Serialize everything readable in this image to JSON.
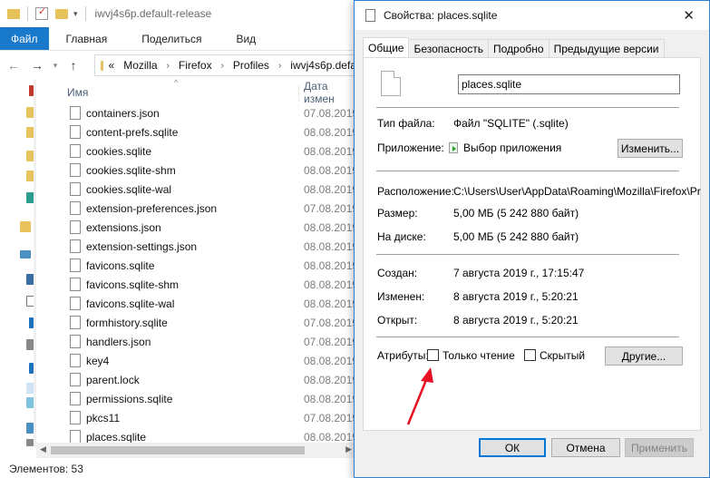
{
  "explorer": {
    "title": "iwvj4s6p.default-release",
    "ribbon_tabs": [
      "Файл",
      "Главная",
      "Поделиться",
      "Вид"
    ],
    "breadcrumb": [
      "«",
      "Mozilla",
      "Firefox",
      "Profiles",
      "iwvj4s6p.defa"
    ],
    "columns": {
      "name": "Имя",
      "date": "Дата измен"
    },
    "files": [
      {
        "name": "containers.json",
        "date": "07.08.2019"
      },
      {
        "name": "content-prefs.sqlite",
        "date": "08.08.2019"
      },
      {
        "name": "cookies.sqlite",
        "date": "08.08.2019"
      },
      {
        "name": "cookies.sqlite-shm",
        "date": "08.08.2019"
      },
      {
        "name": "cookies.sqlite-wal",
        "date": "08.08.2019"
      },
      {
        "name": "extension-preferences.json",
        "date": "07.08.2019"
      },
      {
        "name": "extensions.json",
        "date": "08.08.2019"
      },
      {
        "name": "extension-settings.json",
        "date": "08.08.2019"
      },
      {
        "name": "favicons.sqlite",
        "date": "08.08.2019"
      },
      {
        "name": "favicons.sqlite-shm",
        "date": "08.08.2019"
      },
      {
        "name": "favicons.sqlite-wal",
        "date": "08.08.2019"
      },
      {
        "name": "formhistory.sqlite",
        "date": "07.08.2019"
      },
      {
        "name": "handlers.json",
        "date": "07.08.2019"
      },
      {
        "name": "key4",
        "date": "08.08.2019"
      },
      {
        "name": "parent.lock",
        "date": "08.08.2019"
      },
      {
        "name": "permissions.sqlite",
        "date": "08.08.2019"
      },
      {
        "name": "pkcs11",
        "date": "07.08.2019"
      },
      {
        "name": "places.sqlite",
        "date": "08.08.2019"
      }
    ],
    "status": "Элементов: 53"
  },
  "dialog": {
    "title": "Свойства: places.sqlite",
    "tabs": [
      "Общие",
      "Безопасность",
      "Подробно",
      "Предыдущие версии"
    ],
    "filename": "places.sqlite",
    "type_label": "Тип файла:",
    "type_value": "Файл \"SQLITE\" (.sqlite)",
    "app_label": "Приложение:",
    "app_value": "Выбор приложения",
    "change_button": "Изменить...",
    "location_label": "Расположение:",
    "location_value": "C:\\Users\\User\\AppData\\Roaming\\Mozilla\\Firefox\\Pr",
    "size_label": "Размер:",
    "size_value": "5,00 МБ (5 242 880 байт)",
    "disk_label": "На диске:",
    "disk_value": "5,00 МБ (5 242 880 байт)",
    "created_label": "Создан:",
    "created_value": "7 августа 2019 г., 17:15:47",
    "modified_label": "Изменен:",
    "modified_value": "8 августа 2019 г., 5:20:21",
    "opened_label": "Открыт:",
    "opened_value": "8 августа 2019 г., 5:20:21",
    "attributes_label": "Атрибуты:",
    "readonly_label": "Только чтение",
    "hidden_label": "Скрытый",
    "other_button": "Другие...",
    "ok_button": "ОК",
    "cancel_button": "Отмена",
    "apply_button": "Применить"
  },
  "colors": {
    "accent": "#1979ca",
    "arrow": "#e81123"
  }
}
